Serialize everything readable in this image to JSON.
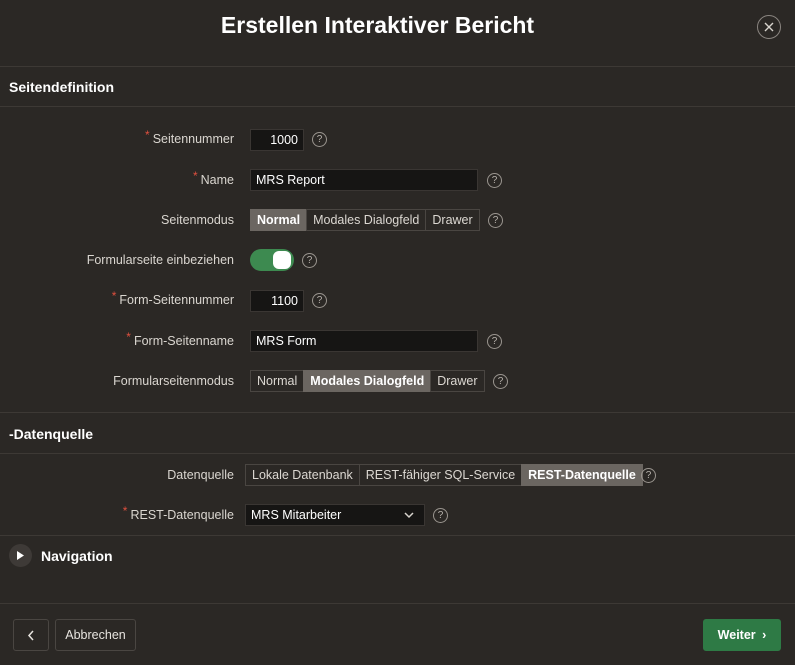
{
  "dialog": {
    "title": "Erstellen Interaktiver Bericht"
  },
  "page_definition": {
    "heading": "Seitendefinition",
    "page_number": {
      "label": "Seitennummer",
      "value": "1000",
      "required": true
    },
    "name": {
      "label": "Name",
      "value": "MRS Report",
      "required": true
    },
    "page_mode": {
      "label": "Seitenmodus",
      "options": [
        "Normal",
        "Modales Dialogfeld",
        "Drawer"
      ],
      "selected": "Normal"
    },
    "include_form": {
      "label": "Formularseite einbeziehen",
      "checked": true
    },
    "form_page_number": {
      "label": "Form-Seitennummer",
      "value": "1100",
      "required": true
    },
    "form_page_name": {
      "label": "Form-Seitenname",
      "value": "MRS Form",
      "required": true
    },
    "form_page_mode": {
      "label": "Formularseitenmodus",
      "options": [
        "Normal",
        "Modales Dialogfeld",
        "Drawer"
      ],
      "selected": "Modales Dialogfeld"
    },
    "help_glyph": "?"
  },
  "data_source": {
    "heading": "-Datenquelle",
    "source": {
      "label": "Datenquelle",
      "options": [
        "Lokale Datenbank",
        "REST-fähiger SQL-Service",
        "REST-Datenquelle"
      ],
      "selected": "REST-Datenquelle"
    },
    "rest_source": {
      "label": "REST-Datenquelle",
      "value": "MRS Mitarbeiter",
      "required": true
    }
  },
  "navigation": {
    "heading": "Navigation",
    "expanded": false
  },
  "footer": {
    "cancel_label": "Abbrechen",
    "next_label": "Weiter",
    "next_chevron": "›"
  },
  "colors": {
    "background": "#2b2825",
    "primary": "#2e7a45",
    "toggle_on": "#3d8a50",
    "required": "#e0503f"
  }
}
